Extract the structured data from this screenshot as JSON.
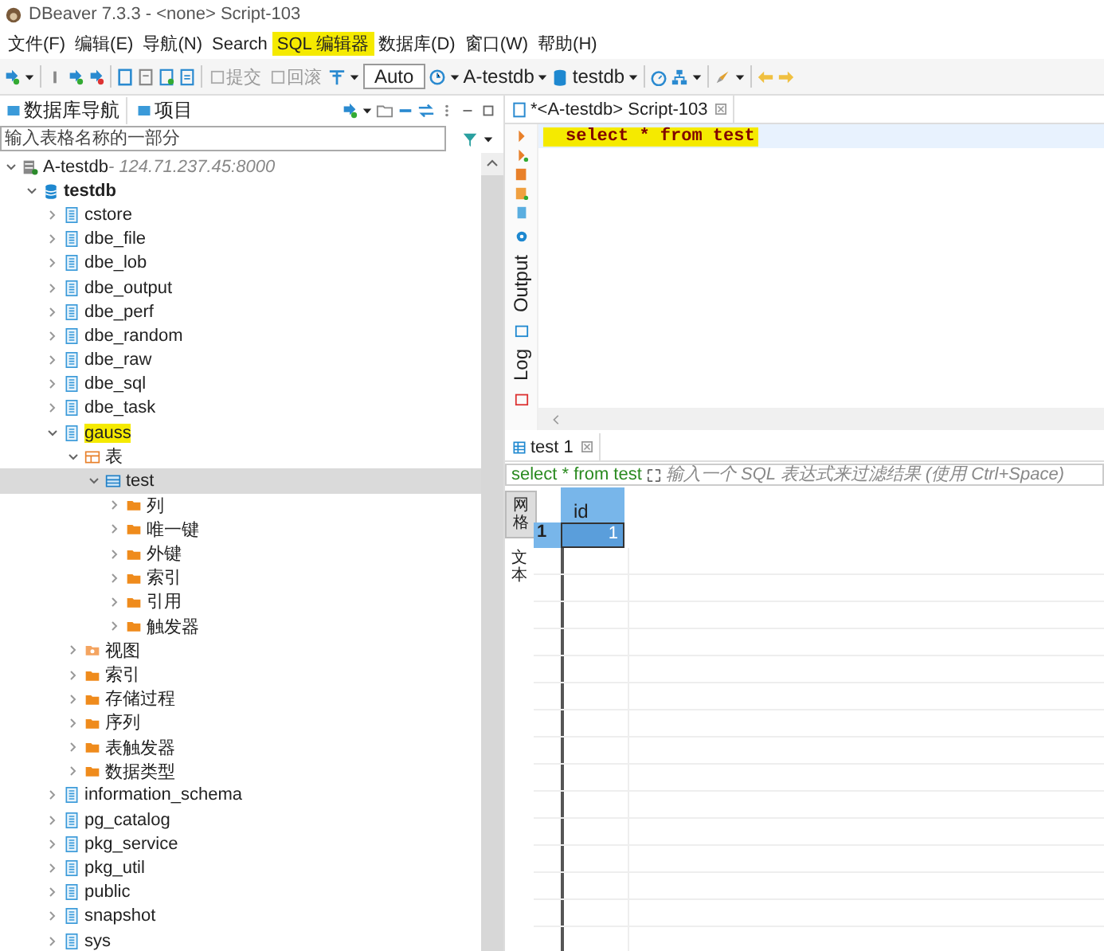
{
  "window": {
    "title": "DBeaver 7.3.3 - <none> Script-103"
  },
  "menu": [
    {
      "label": "文件(F)",
      "highlighted": false
    },
    {
      "label": "编辑(E)",
      "highlighted": false
    },
    {
      "label": "导航(N)",
      "highlighted": false
    },
    {
      "label": "Search",
      "highlighted": false
    },
    {
      "label": "SQL 编辑器",
      "highlighted": true
    },
    {
      "label": "数据库(D)",
      "highlighted": false
    },
    {
      "label": "窗口(W)",
      "highlighted": false
    },
    {
      "label": "帮助(H)",
      "highlighted": false
    }
  ],
  "toolbar": {
    "commit": {
      "label": "提交",
      "disabled": true
    },
    "rollback": {
      "label": "回滚",
      "disabled": true
    },
    "mode": "Auto",
    "connection": "A-testdb",
    "database": "testdb"
  },
  "navigator": {
    "tabs": [
      {
        "label": "数据库导航",
        "selected": true
      },
      {
        "label": "项目",
        "selected": false
      }
    ],
    "filter_placeholder": "输入表格名称的一部分"
  },
  "tree": [
    {
      "kind": "connection",
      "label": "A-testdb",
      "address": " - 124.71.237.45:8000",
      "expanded": true,
      "selected": false,
      "highlighted": false,
      "children": [
        {
          "kind": "database",
          "label": "testdb",
          "expanded": true,
          "selected": false,
          "highlighted": false,
          "children": [
            {
              "kind": "schema",
              "label": "cstore",
              "expanded": false,
              "selected": false,
              "highlighted": false
            },
            {
              "kind": "schema",
              "label": "dbe_file",
              "expanded": false,
              "selected": false,
              "highlighted": false
            },
            {
              "kind": "schema",
              "label": "dbe_lob",
              "expanded": false,
              "selected": false,
              "highlighted": false
            },
            {
              "kind": "schema",
              "label": "dbe_output",
              "expanded": false,
              "selected": false,
              "highlighted": false
            },
            {
              "kind": "schema",
              "label": "dbe_perf",
              "expanded": false,
              "selected": false,
              "highlighted": false
            },
            {
              "kind": "schema",
              "label": "dbe_random",
              "expanded": false,
              "selected": false,
              "highlighted": false
            },
            {
              "kind": "schema",
              "label": "dbe_raw",
              "expanded": false,
              "selected": false,
              "highlighted": false
            },
            {
              "kind": "schema",
              "label": "dbe_sql",
              "expanded": false,
              "selected": false,
              "highlighted": false
            },
            {
              "kind": "schema",
              "label": "dbe_task",
              "expanded": false,
              "selected": false,
              "highlighted": false
            },
            {
              "kind": "schema",
              "label": "gauss",
              "expanded": true,
              "selected": false,
              "highlighted": true,
              "children": [
                {
                  "kind": "tables",
                  "label": "表",
                  "expanded": true,
                  "selected": false,
                  "highlighted": false,
                  "children": [
                    {
                      "kind": "table",
                      "label": "test",
                      "expanded": true,
                      "selected": true,
                      "highlighted": false,
                      "children": [
                        {
                          "kind": "folder",
                          "label": "列",
                          "expanded": false,
                          "selected": false,
                          "highlighted": false
                        },
                        {
                          "kind": "folder",
                          "label": "唯一键",
                          "expanded": false,
                          "selected": false,
                          "highlighted": false
                        },
                        {
                          "kind": "folder",
                          "label": "外键",
                          "expanded": false,
                          "selected": false,
                          "highlighted": false
                        },
                        {
                          "kind": "folder",
                          "label": "索引",
                          "expanded": false,
                          "selected": false,
                          "highlighted": false
                        },
                        {
                          "kind": "folder",
                          "label": "引用",
                          "expanded": false,
                          "selected": false,
                          "highlighted": false
                        },
                        {
                          "kind": "folder",
                          "label": "触发器",
                          "expanded": false,
                          "selected": false,
                          "highlighted": false
                        }
                      ]
                    }
                  ]
                },
                {
                  "kind": "views",
                  "label": "视图",
                  "expanded": false,
                  "selected": false,
                  "highlighted": false
                },
                {
                  "kind": "folder",
                  "label": "索引",
                  "expanded": false,
                  "selected": false,
                  "highlighted": false
                },
                {
                  "kind": "folder",
                  "label": "存储过程",
                  "expanded": false,
                  "selected": false,
                  "highlighted": false
                },
                {
                  "kind": "folder",
                  "label": "序列",
                  "expanded": false,
                  "selected": false,
                  "highlighted": false
                },
                {
                  "kind": "folder",
                  "label": "表触发器",
                  "expanded": false,
                  "selected": false,
                  "highlighted": false
                },
                {
                  "kind": "folder",
                  "label": "数据类型",
                  "expanded": false,
                  "selected": false,
                  "highlighted": false
                }
              ]
            },
            {
              "kind": "schema",
              "label": "information_schema",
              "expanded": false,
              "selected": false,
              "highlighted": false
            },
            {
              "kind": "schema",
              "label": "pg_catalog",
              "expanded": false,
              "selected": false,
              "highlighted": false
            },
            {
              "kind": "schema",
              "label": "pkg_service",
              "expanded": false,
              "selected": false,
              "highlighted": false
            },
            {
              "kind": "schema",
              "label": "pkg_util",
              "expanded": false,
              "selected": false,
              "highlighted": false
            },
            {
              "kind": "schema",
              "label": "public",
              "expanded": false,
              "selected": false,
              "highlighted": false
            },
            {
              "kind": "schema",
              "label": "snapshot",
              "expanded": false,
              "selected": false,
              "highlighted": false
            },
            {
              "kind": "schema",
              "label": "sys",
              "expanded": false,
              "selected": false,
              "highlighted": false
            }
          ]
        }
      ]
    }
  ],
  "editor": {
    "tab": "*<A-testdb> Script-103",
    "code": "select * from test",
    "code_highlighted": true,
    "side_tabs": [
      {
        "label": "Output"
      },
      {
        "label": "Log"
      }
    ]
  },
  "results": {
    "tab": "test 1",
    "query": "select * from test",
    "filter_placeholder": "输入一个 SQL 表达式来过滤结果 (使用 Ctrl+Space)",
    "views": [
      {
        "label": "网格",
        "selected": true
      },
      {
        "label": "文本",
        "selected": false
      }
    ],
    "columns": [
      "id"
    ],
    "rows": [
      {
        "number": "1",
        "cells": [
          "1"
        ],
        "selected": true
      }
    ]
  }
}
